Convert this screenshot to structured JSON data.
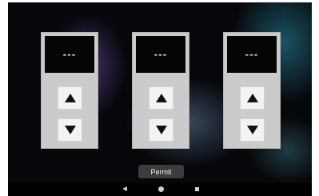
{
  "panels": [
    {
      "display": "---",
      "up_icon": "arrow-up-icon",
      "down_icon": "arrow-down-icon"
    },
    {
      "display": "---",
      "up_icon": "arrow-up-icon",
      "down_icon": "arrow-down-icon"
    },
    {
      "display": "---",
      "up_icon": "arrow-up-icon",
      "down_icon": "arrow-down-icon"
    }
  ],
  "permit_button": {
    "label": "Permit"
  },
  "navbar": {
    "icons": [
      "back-icon",
      "home-icon",
      "recent-apps-icon"
    ]
  },
  "colors": {
    "panel": "#cbcbcb",
    "display": "#050505",
    "button": "#f3f3f3",
    "permit": "#3c3c3c"
  }
}
